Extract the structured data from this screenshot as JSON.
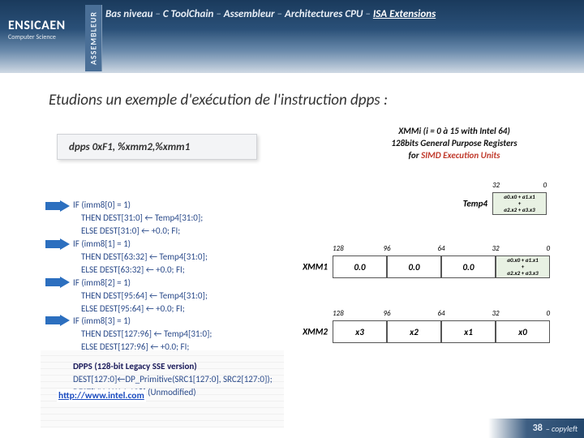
{
  "header": {
    "logo_big": "ENSICAEN",
    "logo_small": "Computer Science",
    "sidetab": "ASSEMBLEUR",
    "crumbs": [
      "Bas niveau",
      "C ToolChain",
      "Assembleur",
      "Architectures CPU",
      "ISA Extensions"
    ],
    "active_idx": 4
  },
  "title": "Etudions un exemple d'exécution de l'instruction dpps :",
  "codebox": "dpps   0xF1, %xmm2,%xmm1",
  "regdesc": {
    "l1": "XMMi (i = 0 à 15 with Intel 64)",
    "l2": "128bits General Purpose Registers",
    "l3_a": "for ",
    "l3_b": "SIMD Execution Units"
  },
  "pseudo": [
    "IF (imm8[0] = 1)",
    "    THEN DEST[31:0] ← Temp4[31:0];",
    "    ELSE DEST[31:0] ← +0.0; FI;",
    "IF (imm8[1] = 1)",
    "    THEN DEST[63:32] ← Temp4[31:0];",
    "    ELSE DEST[63:32] ← +0.0; FI;",
    "IF (imm8[2] = 1)",
    "    THEN DEST[95:64] ← Temp4[31:0];",
    "    ELSE DEST[95:64] ← +0.0; FI;",
    "IF (imm8[3] = 1)",
    "    THEN DEST[127:96] ← Temp4[31:0];",
    "    ELSE DEST[127:96] ← +0.0; FI;"
  ],
  "pseudo_footer": [
    "DPPS (128-bit Legacy SSE version)",
    "DEST[127:0]←DP_Primitive(SRC1[127:0], SRC2[127:0]);",
    "DEST[VLMAX-1:128] (Unmodified)"
  ],
  "arrow_color": "#2c6fbf",
  "regs": {
    "temp4": {
      "label": "Temp4",
      "cells": [
        "a0.x0 + a1.x1\n+\na2.x2 + a3.x3"
      ],
      "cls": [
        "formula w"
      ],
      "bits": [
        "32",
        "0"
      ]
    },
    "xmm1": {
      "label": "XMM1",
      "cells": [
        "0.0",
        "0.0",
        "0.0",
        "a0.x0 + a1.x1\n+\na2.x2 + a3.x3"
      ],
      "cls": [
        "w",
        "w",
        "w",
        "formula w"
      ],
      "bits": [
        "128",
        "96",
        "64",
        "32",
        "0"
      ]
    },
    "xmm2": {
      "label": "XMM2",
      "cells": [
        "x3",
        "x2",
        "x1",
        "x0"
      ],
      "cls": [
        "w",
        "w",
        "w",
        "w"
      ],
      "bits": [
        "128",
        "96",
        "64",
        "32",
        "0"
      ]
    }
  },
  "link": "http://www.intel.com",
  "footer": {
    "page": "38",
    "suffix": " – copyleft"
  }
}
